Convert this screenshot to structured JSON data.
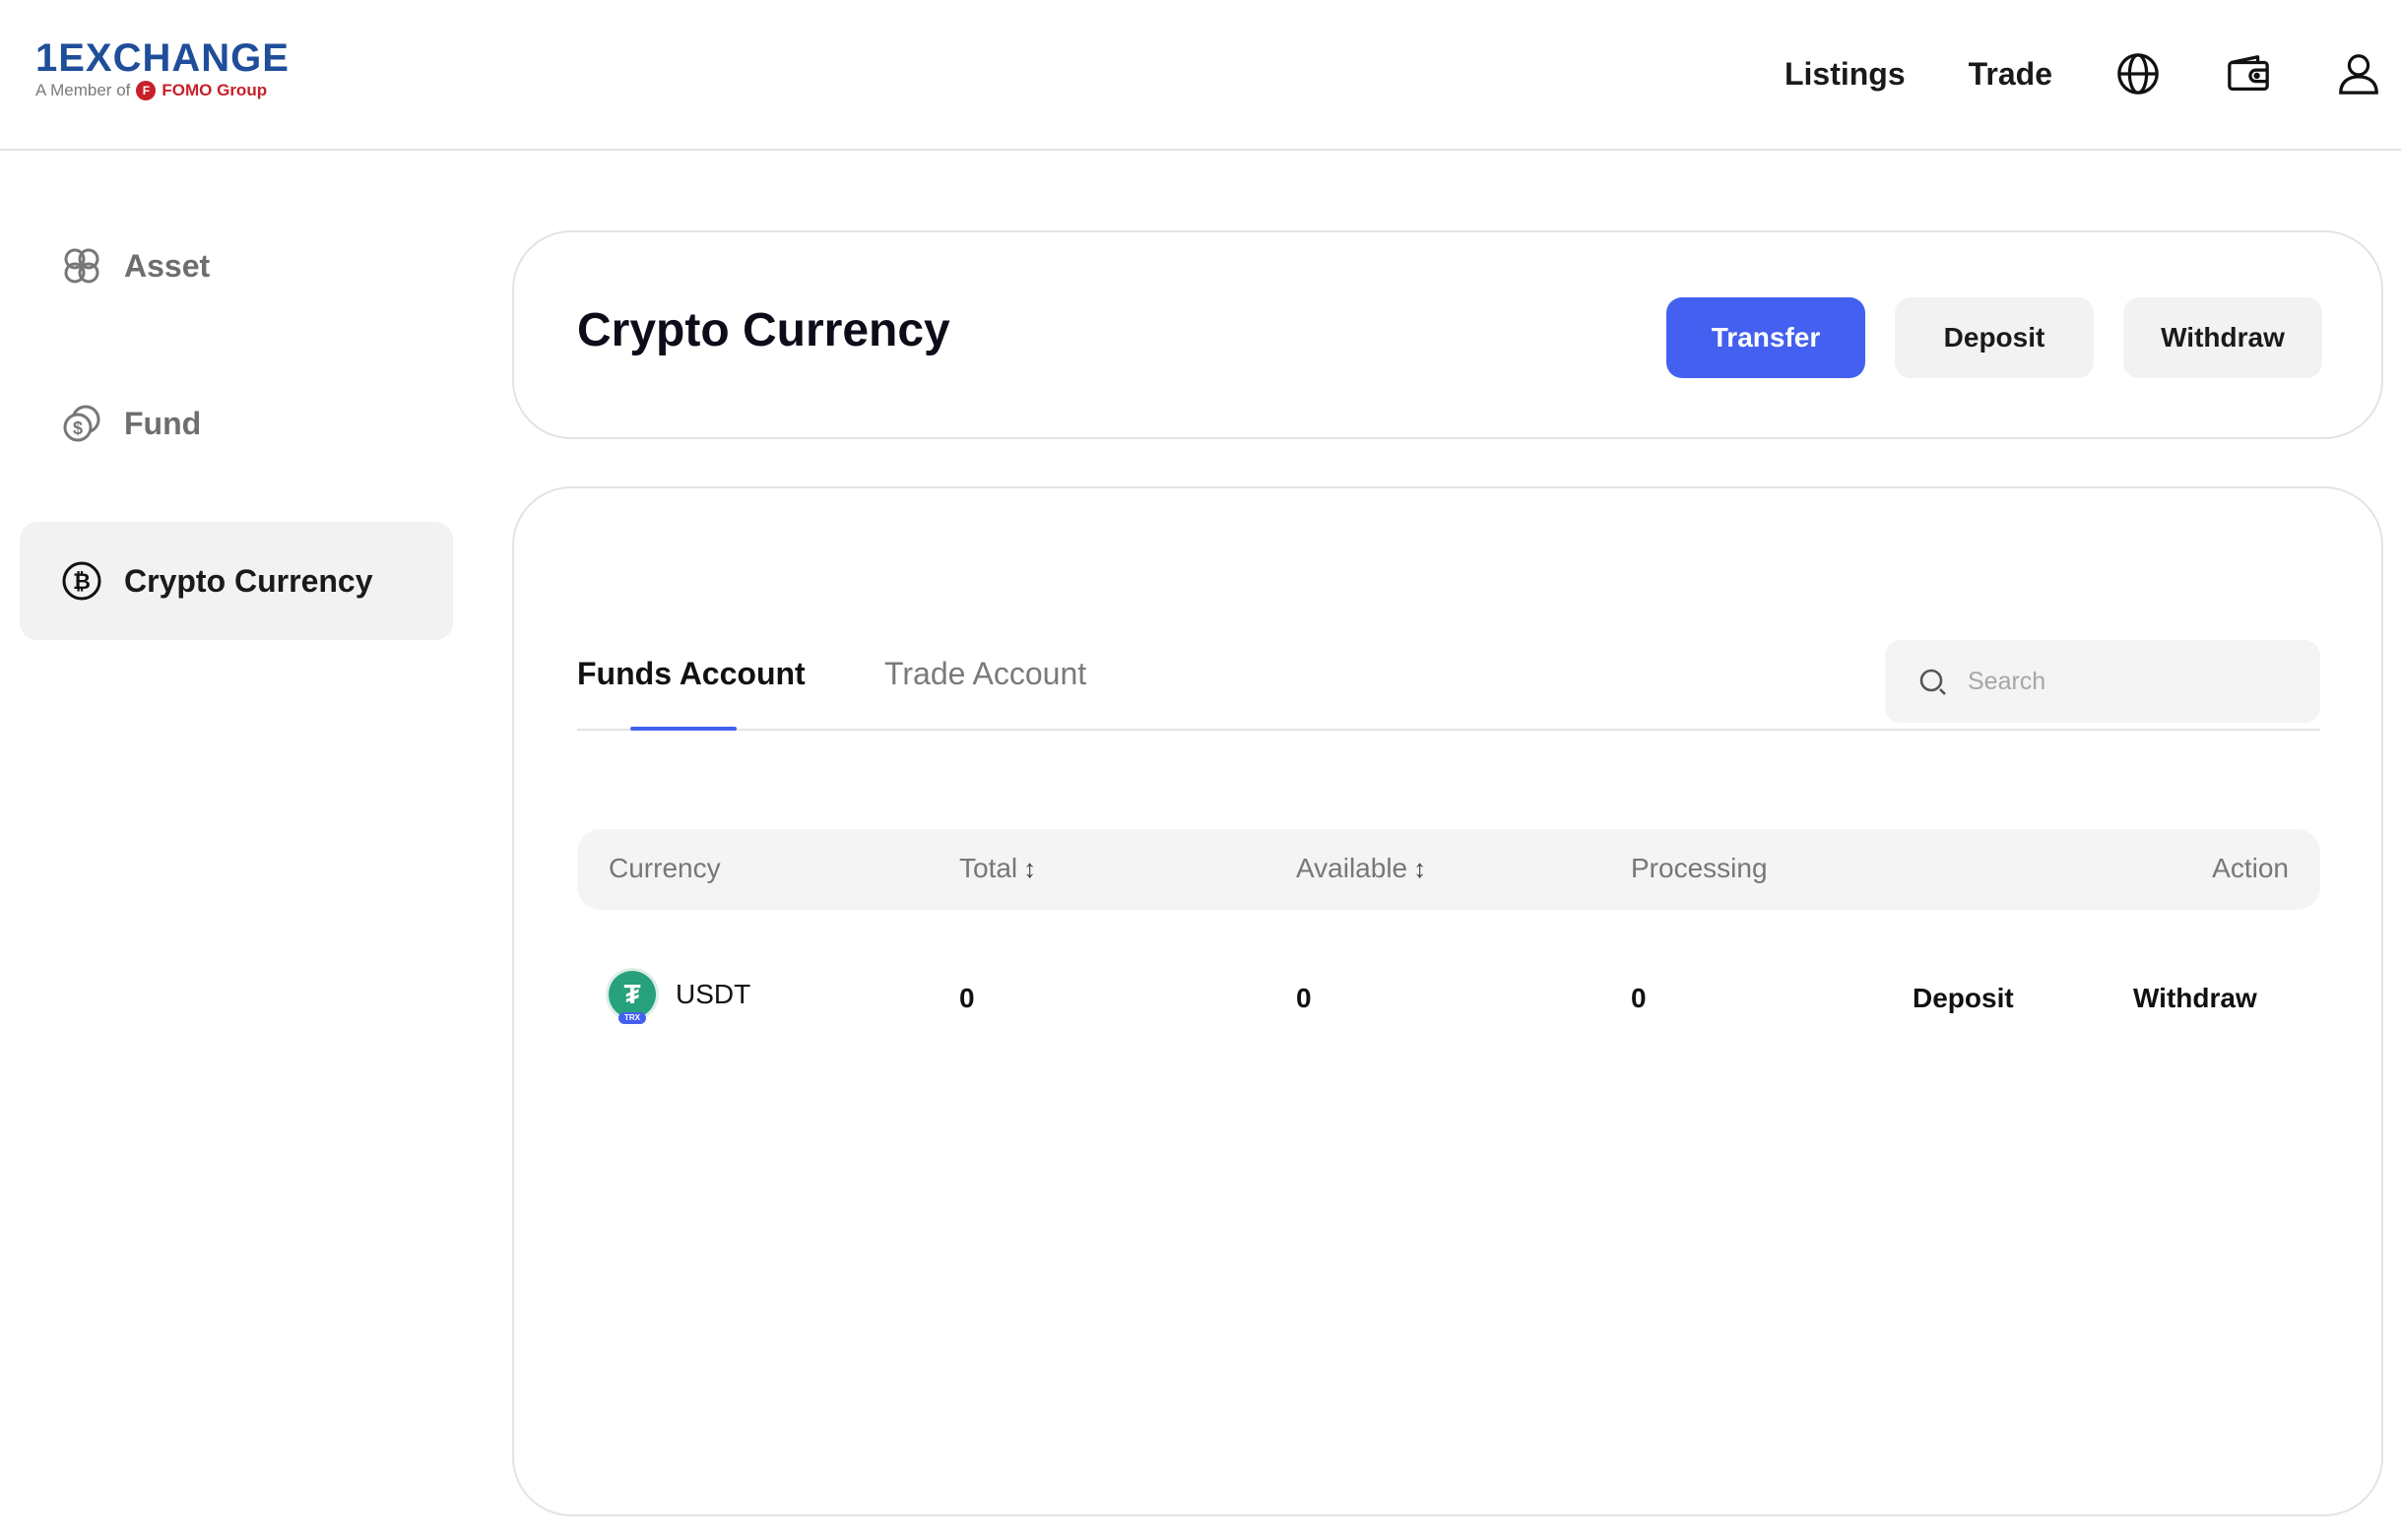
{
  "brand": {
    "logo_text": "1EXCHANGE",
    "tagline_prefix": "A Member of",
    "tagline_group": "FOMO Group"
  },
  "topnav": {
    "listings": "Listings",
    "trade": "Trade",
    "icons": [
      "globe-icon",
      "wallet-icon",
      "user-icon"
    ]
  },
  "sidebar": {
    "items": [
      {
        "label": "Asset",
        "icon": "asset-icon",
        "active": false
      },
      {
        "label": "Fund",
        "icon": "coins-icon",
        "active": false
      },
      {
        "label": "Crypto Currency",
        "icon": "bitcoin-icon",
        "active": true
      }
    ]
  },
  "header": {
    "title": "Crypto Currency",
    "transfer_label": "Transfer",
    "deposit_label": "Deposit",
    "withdraw_label": "Withdraw"
  },
  "tabs": {
    "funds": "Funds Account",
    "trade": "Trade Account",
    "active": "funds"
  },
  "search": {
    "placeholder": "Search",
    "value": ""
  },
  "table": {
    "columns": {
      "currency": "Currency",
      "total": "Total",
      "available": "Available",
      "processing": "Processing",
      "action": "Action"
    },
    "sort_glyph": "↕",
    "rows": [
      {
        "currency": "USDT",
        "network_badge": "TRX",
        "total": "0",
        "available": "0",
        "processing": "0",
        "deposit": "Deposit",
        "withdraw": "Withdraw"
      }
    ]
  },
  "colors": {
    "accent": "#4460f0",
    "usdt": "#26a17b",
    "fomo": "#c8202a"
  }
}
